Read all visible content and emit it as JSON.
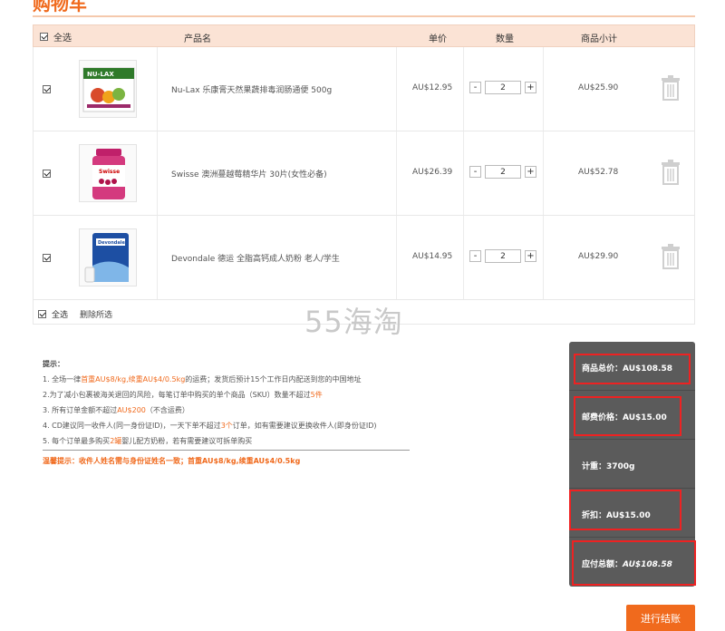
{
  "page": {
    "title": "购物车"
  },
  "header": {
    "select_all": "全选",
    "product": "产品名",
    "price": "单价",
    "quantity": "数量",
    "subtotal": "商品小计"
  },
  "items": [
    {
      "name": "Nu-Lax 乐康膏天然果蔬排毒润肠通便 500g",
      "price": "AU$12.95",
      "quantity": "2",
      "subtotal": "AU$25.90",
      "checked": true,
      "minus": "-",
      "plus": "+"
    },
    {
      "name": "Swisse 澳洲蔓越莓精华片 30片(女性必备)",
      "price": "AU$26.39",
      "quantity": "2",
      "subtotal": "AU$52.78",
      "checked": true,
      "minus": "-",
      "plus": "+"
    },
    {
      "name": "Devondale 德运 全脂高钙成人奶粉 老人/学生",
      "price": "AU$14.95",
      "quantity": "2",
      "subtotal": "AU$29.90",
      "checked": true,
      "minus": "-",
      "plus": "+"
    }
  ],
  "footer": {
    "select_all": "全选",
    "delete_selected": "删除所选"
  },
  "watermark": "55海淘",
  "tips": {
    "title": "提示：",
    "line1_a": "1. 全场一律",
    "line1_b": "首重AU$8/kg,续重AU$4/0.5kg",
    "line1_c": "的运费；发货后预计15个工作日内配送到您的中国地址",
    "line2_a": "2.为了减小包裹被海关退回的风险，每笔订单中购买的单个商品（SKU）数量不超过",
    "line2_b": "5件",
    "line3_a": "3. 所有订单金额不超过",
    "line3_b": "AU$200",
    "line3_c": "（不含运费）",
    "line4_a": "4. CD建议同一收件人(同一身份证ID)，一天下单不超过",
    "line4_b": "3个",
    "line4_c": "订单，如有需要建议更换收件人(即身份证ID)",
    "line5_a": "5. 每个订单最多购买",
    "line5_b": "2罐",
    "line5_c": "婴儿配方奶粉，若有需要建议可拆单购买",
    "warm": "温馨提示：收件人姓名需与身份证姓名一致；首重AU$8/kg,续重AU$4/0.5kg"
  },
  "summary": {
    "total_goods": "商品总价：AU$108.58",
    "shipping": "邮费价格：AU$15.00",
    "weight": "计重：3700g",
    "discount": "折扣：AU$15.00",
    "payable_label": "应付总额：",
    "payable_value": "AU$108.58"
  },
  "checkout": {
    "label": "进行结账"
  },
  "colors": {
    "accent": "#f06a1d",
    "header_bg": "#fbe3d5",
    "summary_bg": "#5b5b5b",
    "highlight": "#e22222"
  }
}
